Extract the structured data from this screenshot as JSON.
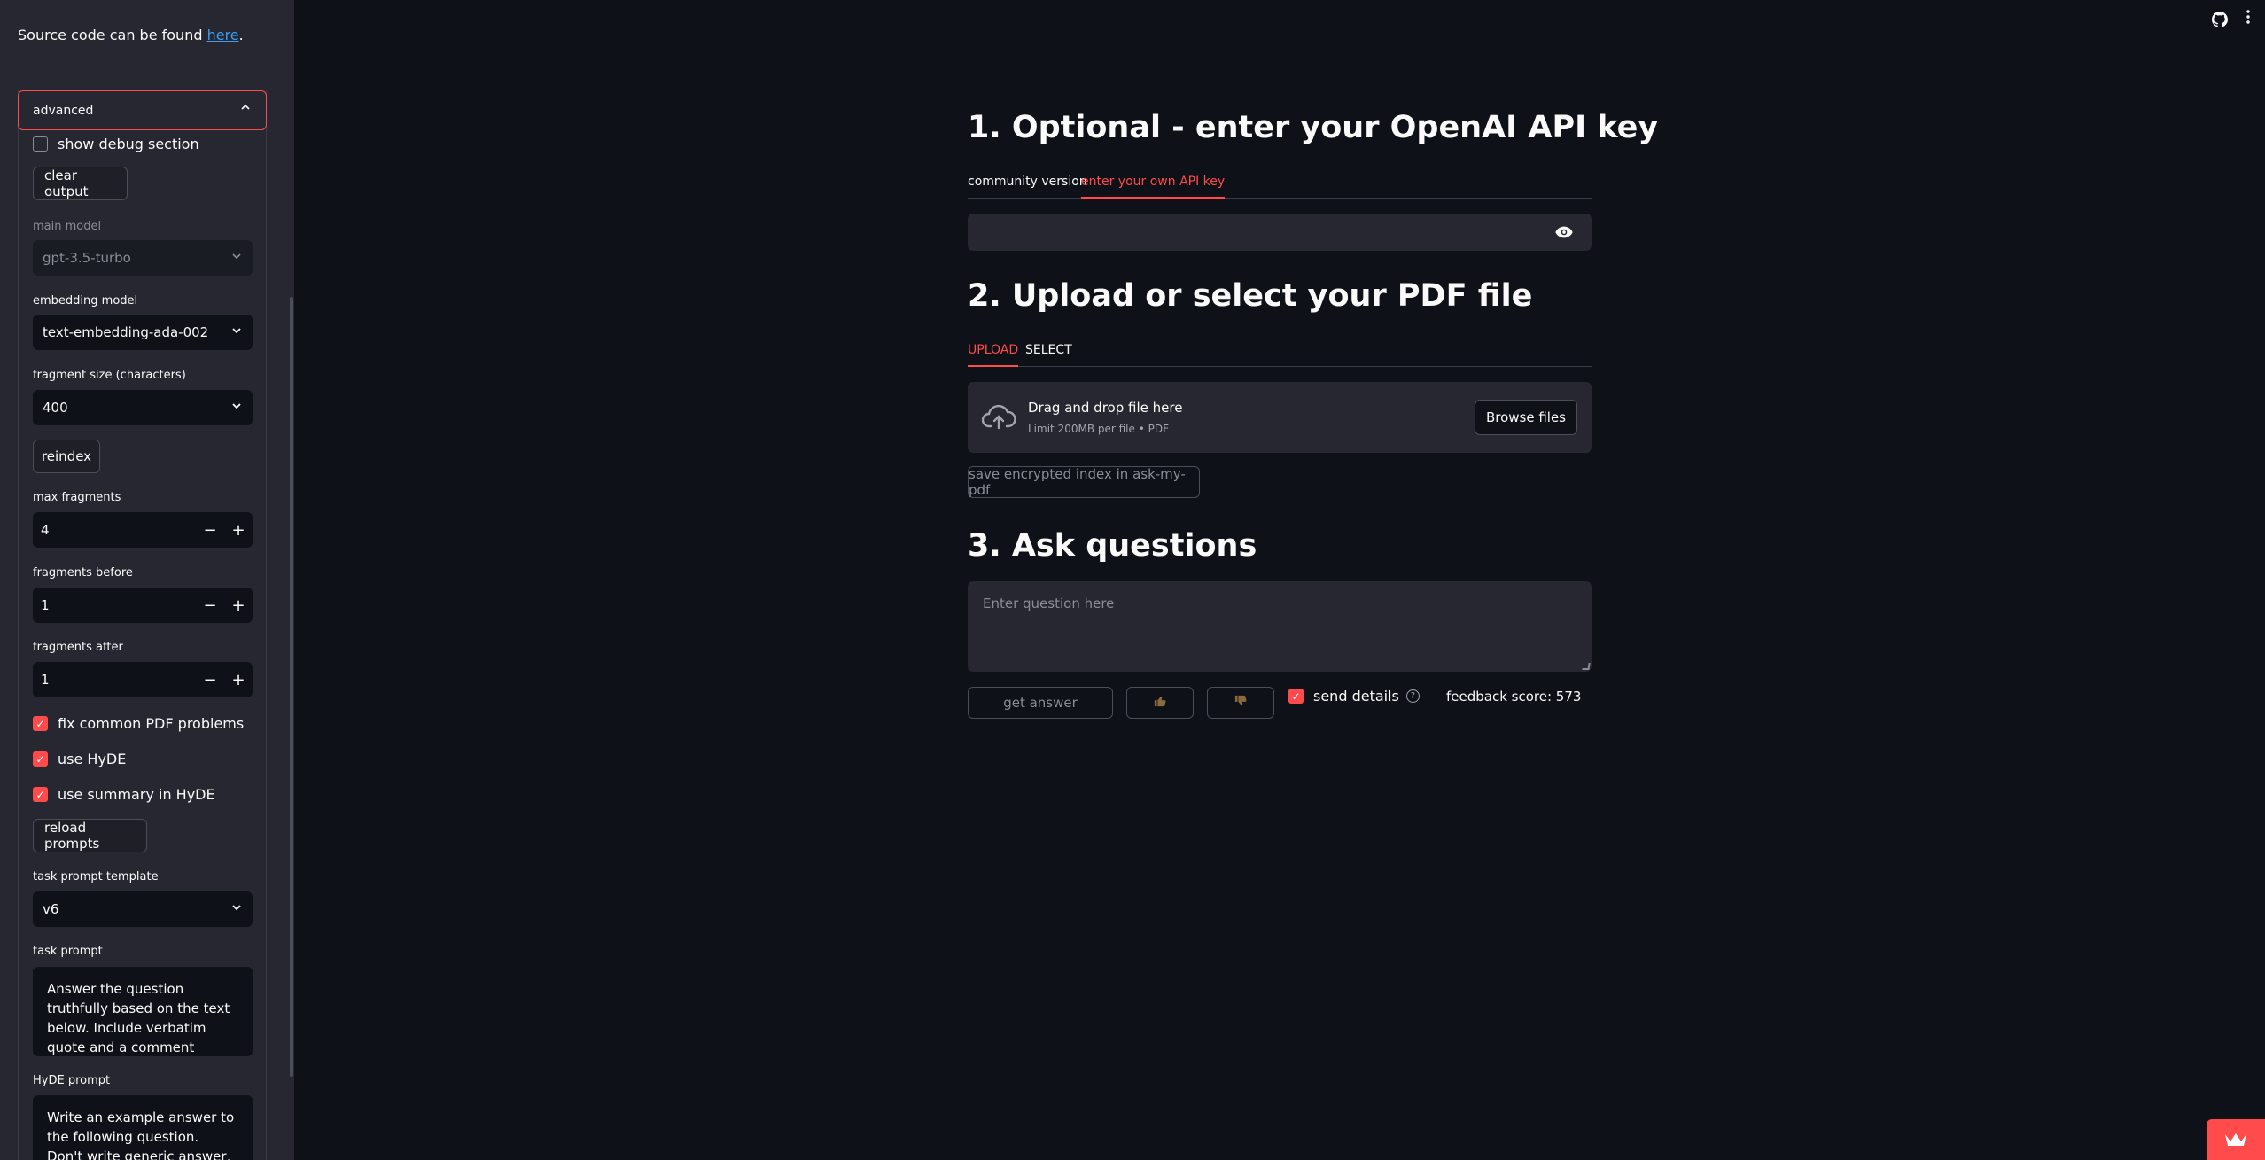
{
  "sidebar": {
    "source_text": "Source code can be found ",
    "source_link": "here",
    "source_end": ".",
    "expander_label": "advanced",
    "debug_label": "show debug section",
    "clear_output": "clear output",
    "main_model_label": "main model",
    "main_model_value": "gpt-3.5-turbo",
    "embedding_model_label": "embedding model",
    "embedding_model_value": "text-embedding-ada-002",
    "fragment_size_label": "fragment size (characters)",
    "fragment_size_value": "400",
    "reindex": "reindex",
    "max_fragments_label": "max fragments",
    "max_fragments_value": "4",
    "fragments_before_label": "fragments before",
    "fragments_before_value": "1",
    "fragments_after_label": "fragments after",
    "fragments_after_value": "1",
    "fix_pdf_label": "fix common PDF problems",
    "use_hyde_label": "use HyDE",
    "use_summary_label": "use summary in HyDE",
    "reload_prompts": "reload prompts",
    "task_template_label": "task prompt template",
    "task_template_value": "v6",
    "task_prompt_label": "task prompt",
    "task_prompt_value": "Answer the question truthfully based on the text below. Include verbatim quote and a comment where to find it in",
    "hyde_prompt_label": "HyDE prompt",
    "hyde_prompt_value": "Write an example answer to the following question. Don't write generic answer, just"
  },
  "main": {
    "h1": "1. Optional - enter your OpenAI API key",
    "api_tabs": [
      "community version",
      "enter your own API key"
    ],
    "h2": "2. Upload or select your PDF file",
    "pdf_tabs": [
      "UPLOAD",
      "SELECT"
    ],
    "upload_title": "Drag and drop file here",
    "upload_sub": "Limit 200MB per file • PDF",
    "browse": "Browse files",
    "save_index": "save encrypted index in ask-my-pdf",
    "h3": "3. Ask questions",
    "question_placeholder": "Enter question here",
    "get_answer": "get answer",
    "send_details": "send details",
    "feedback_score": "feedback score: 573"
  },
  "colors": {
    "accent": "#ff4b4b",
    "bg": "#0e1117",
    "panel": "#262730"
  },
  "icons": [
    "github-icon",
    "kebab-menu-icon",
    "cloud-upload-icon",
    "eye-icon",
    "thumbs-up-icon",
    "thumbs-down-icon",
    "help-icon",
    "chevron-up-icon",
    "chevron-down-icon",
    "crown-badge-icon"
  ]
}
